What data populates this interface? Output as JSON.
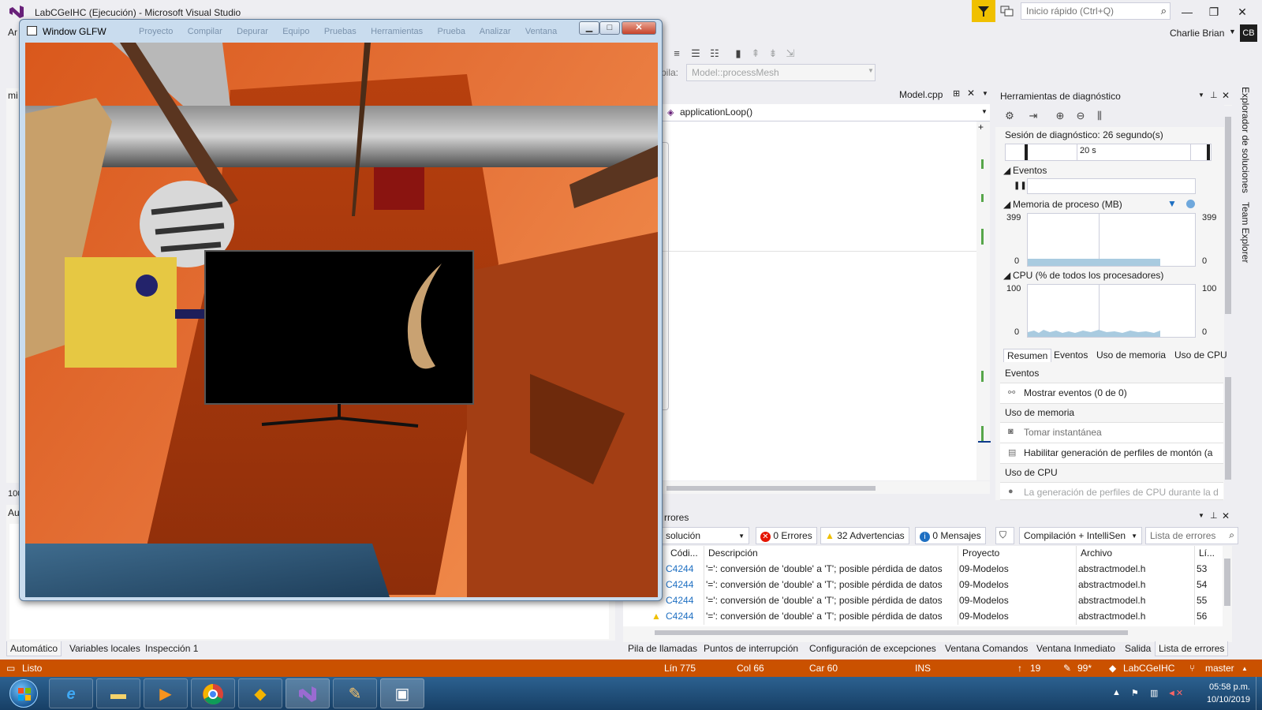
{
  "vs": {
    "title": "LabCGeIHC (Ejecución) - Microsoft Visual Studio",
    "quick_launch_placeholder": "Inicio rápido (Ctrl+Q)",
    "user": "Charlie Brian",
    "avatar_initials": "CB",
    "menu_partial": "Ar",
    "stack_label": "pila:",
    "stack_value": "Model::processMesh"
  },
  "editor": {
    "tab": "Model.cpp",
    "nav_function": "applicationLoop()",
    "left_partial_tab": "mi",
    "zoom_partial": "100"
  },
  "glfw": {
    "title": "Window GLFW",
    "ghost_menu": [
      "Proyecto",
      "Compilar",
      "Depurar",
      "Equipo",
      "Pruebas",
      "Herramientas",
      "Prueba",
      "Analizar",
      "Ventana"
    ]
  },
  "diagnostics": {
    "title": "Herramientas de diagnóstico",
    "session": "Sesión de diagnóstico: 26 segundo(s)",
    "timeline_tick": "20 s",
    "events_label": "Eventos",
    "memory_label": "Memoria de proceso (MB)",
    "memory_max": "399",
    "memory_min": "0",
    "memory_fill": 0.13,
    "cpu_label": "CPU (% de todos los procesadores)",
    "cpu_max": "100",
    "cpu_min": "0",
    "tabs": [
      "Resumen",
      "Eventos",
      "Uso de memoria",
      "Uso de CPU"
    ],
    "list": {
      "events_head": "Eventos",
      "show_events": "Mostrar eventos (0 de 0)",
      "memory_head": "Uso de memoria",
      "snapshot": "Tomar instantánea",
      "heap_profiling": "Habilitar generación de perfiles de montón (a",
      "cpu_head": "Uso de CPU",
      "cpu_note": "La generación de perfiles de CPU durante la d"
    }
  },
  "side_tabs": [
    "Explorador de soluciones",
    "Team Explorer"
  ],
  "errors": {
    "title": "rrores",
    "scope": "solución",
    "errors_btn": "0 Errores",
    "warnings_btn": "32 Advertencias",
    "messages_btn": "0 Mensajes",
    "build_filter": "Compilación + IntelliSen",
    "search_placeholder": "Lista de errores",
    "columns": [
      "Códi...",
      "Descripción",
      "Proyecto",
      "Archivo",
      "Lí..."
    ],
    "rows": [
      {
        "code": "C4244",
        "desc": "'=': conversión de 'double' a 'T'; posible pérdida de datos",
        "project": "09-Modelos",
        "file": "abstractmodel.h",
        "line": "53"
      },
      {
        "code": "C4244",
        "desc": "'=': conversión de 'double' a 'T'; posible pérdida de datos",
        "project": "09-Modelos",
        "file": "abstractmodel.h",
        "line": "54"
      },
      {
        "code": "C4244",
        "desc": "'=': conversión de 'double' a 'T'; posible pérdida de datos",
        "project": "09-Modelos",
        "file": "abstractmodel.h",
        "line": "55"
      },
      {
        "code": "C4244",
        "desc": "'=': conversión de 'double' a 'T'; posible pérdida de datos",
        "project": "09-Modelos",
        "file": "abstractmodel.h",
        "line": "56"
      }
    ]
  },
  "left_bottom_tabs": [
    "Automático",
    "Variables locales",
    "Inspección 1"
  ],
  "left_panel_partial": "Au",
  "right_bottom_tabs": [
    "Pila de llamadas",
    "Puntos de interrupción",
    "Configuración de excepciones",
    "Ventana Comandos",
    "Ventana Inmediato",
    "Salida",
    "Lista de errores"
  ],
  "status": {
    "ready": "Listo",
    "line": "Lín 775",
    "col": "Col 66",
    "car": "Car 60",
    "ins": "INS",
    "up_count": "19",
    "pencil_count": "99*",
    "repo": "LabCGeIHC",
    "branch": "master"
  },
  "taskbar": {
    "time": "05:58 p.m.",
    "date": "10/10/2019"
  },
  "colors": {
    "status_bar": "#CA5100",
    "accent_blue": "#007ACC",
    "warning": "#F0C000"
  }
}
